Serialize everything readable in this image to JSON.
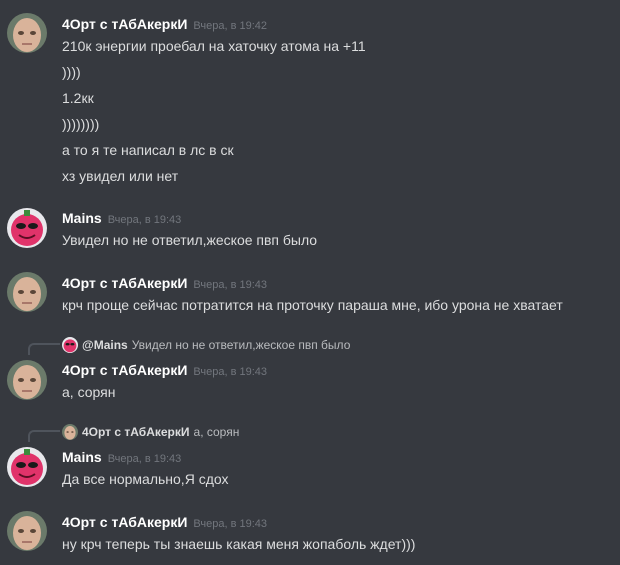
{
  "users": {
    "orto": {
      "name": "4Орт с тАбАкеркИ"
    },
    "mains": {
      "name": "Mains"
    }
  },
  "messages": [
    {
      "author": "4Орт с тАбАкеркИ",
      "time": "Вчера, в 19:42",
      "lines": [
        "210к энергии проебал на хаточку атома на +11",
        "))))",
        "1.2кк",
        "))))))))",
        "а то я те написал в лс в ск",
        "хз увидел или нет"
      ]
    },
    {
      "author": "Mains",
      "time": "Вчера, в 19:43",
      "lines": [
        "Увидел но не ответил,жеское пвп было"
      ]
    },
    {
      "author": "4Орт с тАбАкеркИ",
      "time": "Вчера, в 19:43",
      "lines": [
        "крч проще сейчас потратится на проточку параша мне, ибо урона не хватает"
      ]
    },
    {
      "reply": {
        "name": "@Mains",
        "text": "Увидел но не ответил,жеское пвп было"
      },
      "author": "4Орт с тАбАкеркИ",
      "time": "Вчера, в 19:43",
      "lines": [
        "а, сорян"
      ]
    },
    {
      "reply": {
        "name": "4Орт с тАбАкеркИ",
        "text": "а, сорян"
      },
      "author": "Mains",
      "time": "Вчера, в 19:43",
      "lines": [
        "Да все нормально,Я сдох"
      ]
    },
    {
      "author": "4Орт с тАбАкеркИ",
      "time": "Вчера, в 19:43",
      "lines": [
        "ну крч теперь ты знаешь какая меня жопаболь ждет)))"
      ]
    }
  ],
  "colors": {
    "background": "#36393f",
    "username": "#ffffff",
    "timestamp": "#72767d",
    "text": "#dcddde"
  }
}
